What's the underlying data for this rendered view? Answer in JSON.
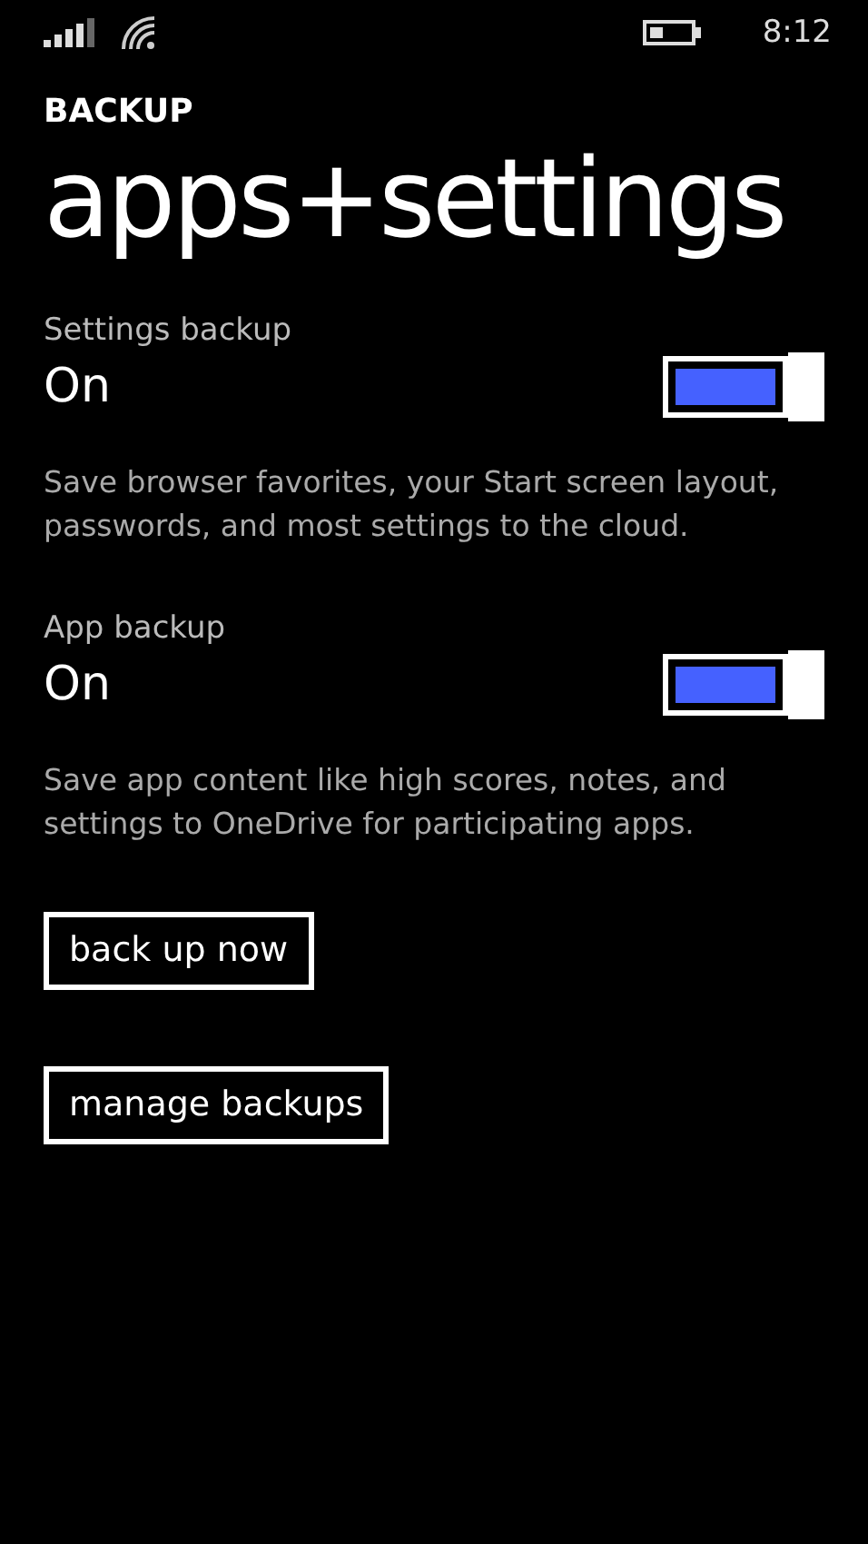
{
  "status_bar": {
    "time": "8:12"
  },
  "header": {
    "section": "BACKUP",
    "title": "apps+settings"
  },
  "settings": [
    {
      "label": "Settings backup",
      "value": "On",
      "on": true,
      "description": "Save browser favorites, your Start screen layout, passwords, and most settings to the cloud."
    },
    {
      "label": "App backup",
      "value": "On",
      "on": true,
      "description": "Save app content like high scores, notes, and settings to OneDrive for participating apps."
    }
  ],
  "buttons": [
    "back up now",
    "manage backups"
  ]
}
